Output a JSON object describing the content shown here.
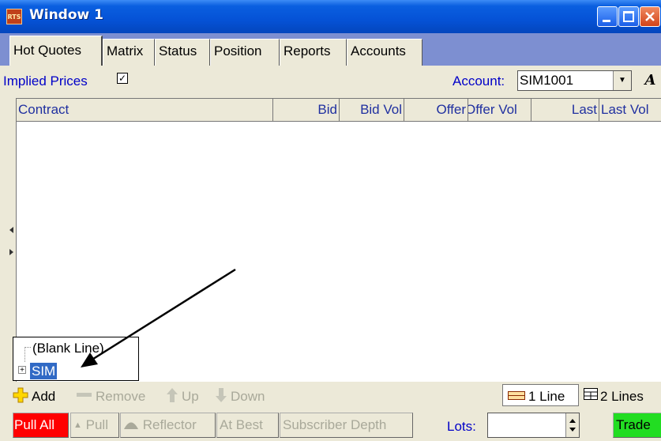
{
  "window": {
    "title": "Window 1",
    "app_icon_text": "RTS"
  },
  "tabs": [
    {
      "label": "Hot Quotes",
      "active": true
    },
    {
      "label": "Matrix"
    },
    {
      "label": "Status"
    },
    {
      "label": "Position"
    },
    {
      "label": "Reports"
    },
    {
      "label": "Accounts"
    }
  ],
  "toolbar": {
    "implied_prices_label": "Implied Prices",
    "implied_prices_checked": true,
    "check_mark": "✓",
    "account_label": "Account:",
    "account_value": "SIM1001",
    "font_button": "A"
  },
  "grid": {
    "columns": [
      "Contract",
      "Bid",
      "Bid Vol",
      "Offer",
      "Offer Vol",
      "Last",
      "Last Vol"
    ]
  },
  "popup": {
    "items": [
      "(Blank Line)",
      "SIM"
    ],
    "expander": "+"
  },
  "row_toolbar": {
    "add": "Add",
    "remove": "Remove",
    "up": "Up",
    "down": "Down",
    "one_line": "1 Line",
    "two_lines": "2 Lines"
  },
  "action_toolbar": {
    "pull_all": "Pull All",
    "pull": "Pull",
    "reflector": "Reflector",
    "at_best": "At Best",
    "subscriber_depth": "Subscriber Depth",
    "lots_label": "Lots:",
    "lots_value": "",
    "trade": "Trade"
  },
  "colors": {
    "titlebar": "#0552d6",
    "tab_strip": "#7d8fd1",
    "pull_all": "#ff0000",
    "trade": "#22dd22",
    "selection": "#316ac5",
    "label_blue": "#0000c8"
  },
  "icons": [
    "minimize-icon",
    "maximize-icon",
    "close-icon",
    "plus-icon",
    "minus-icon",
    "up-arrow-icon",
    "down-arrow-icon",
    "one-line-icon",
    "two-lines-icon",
    "reflector-icon"
  ]
}
